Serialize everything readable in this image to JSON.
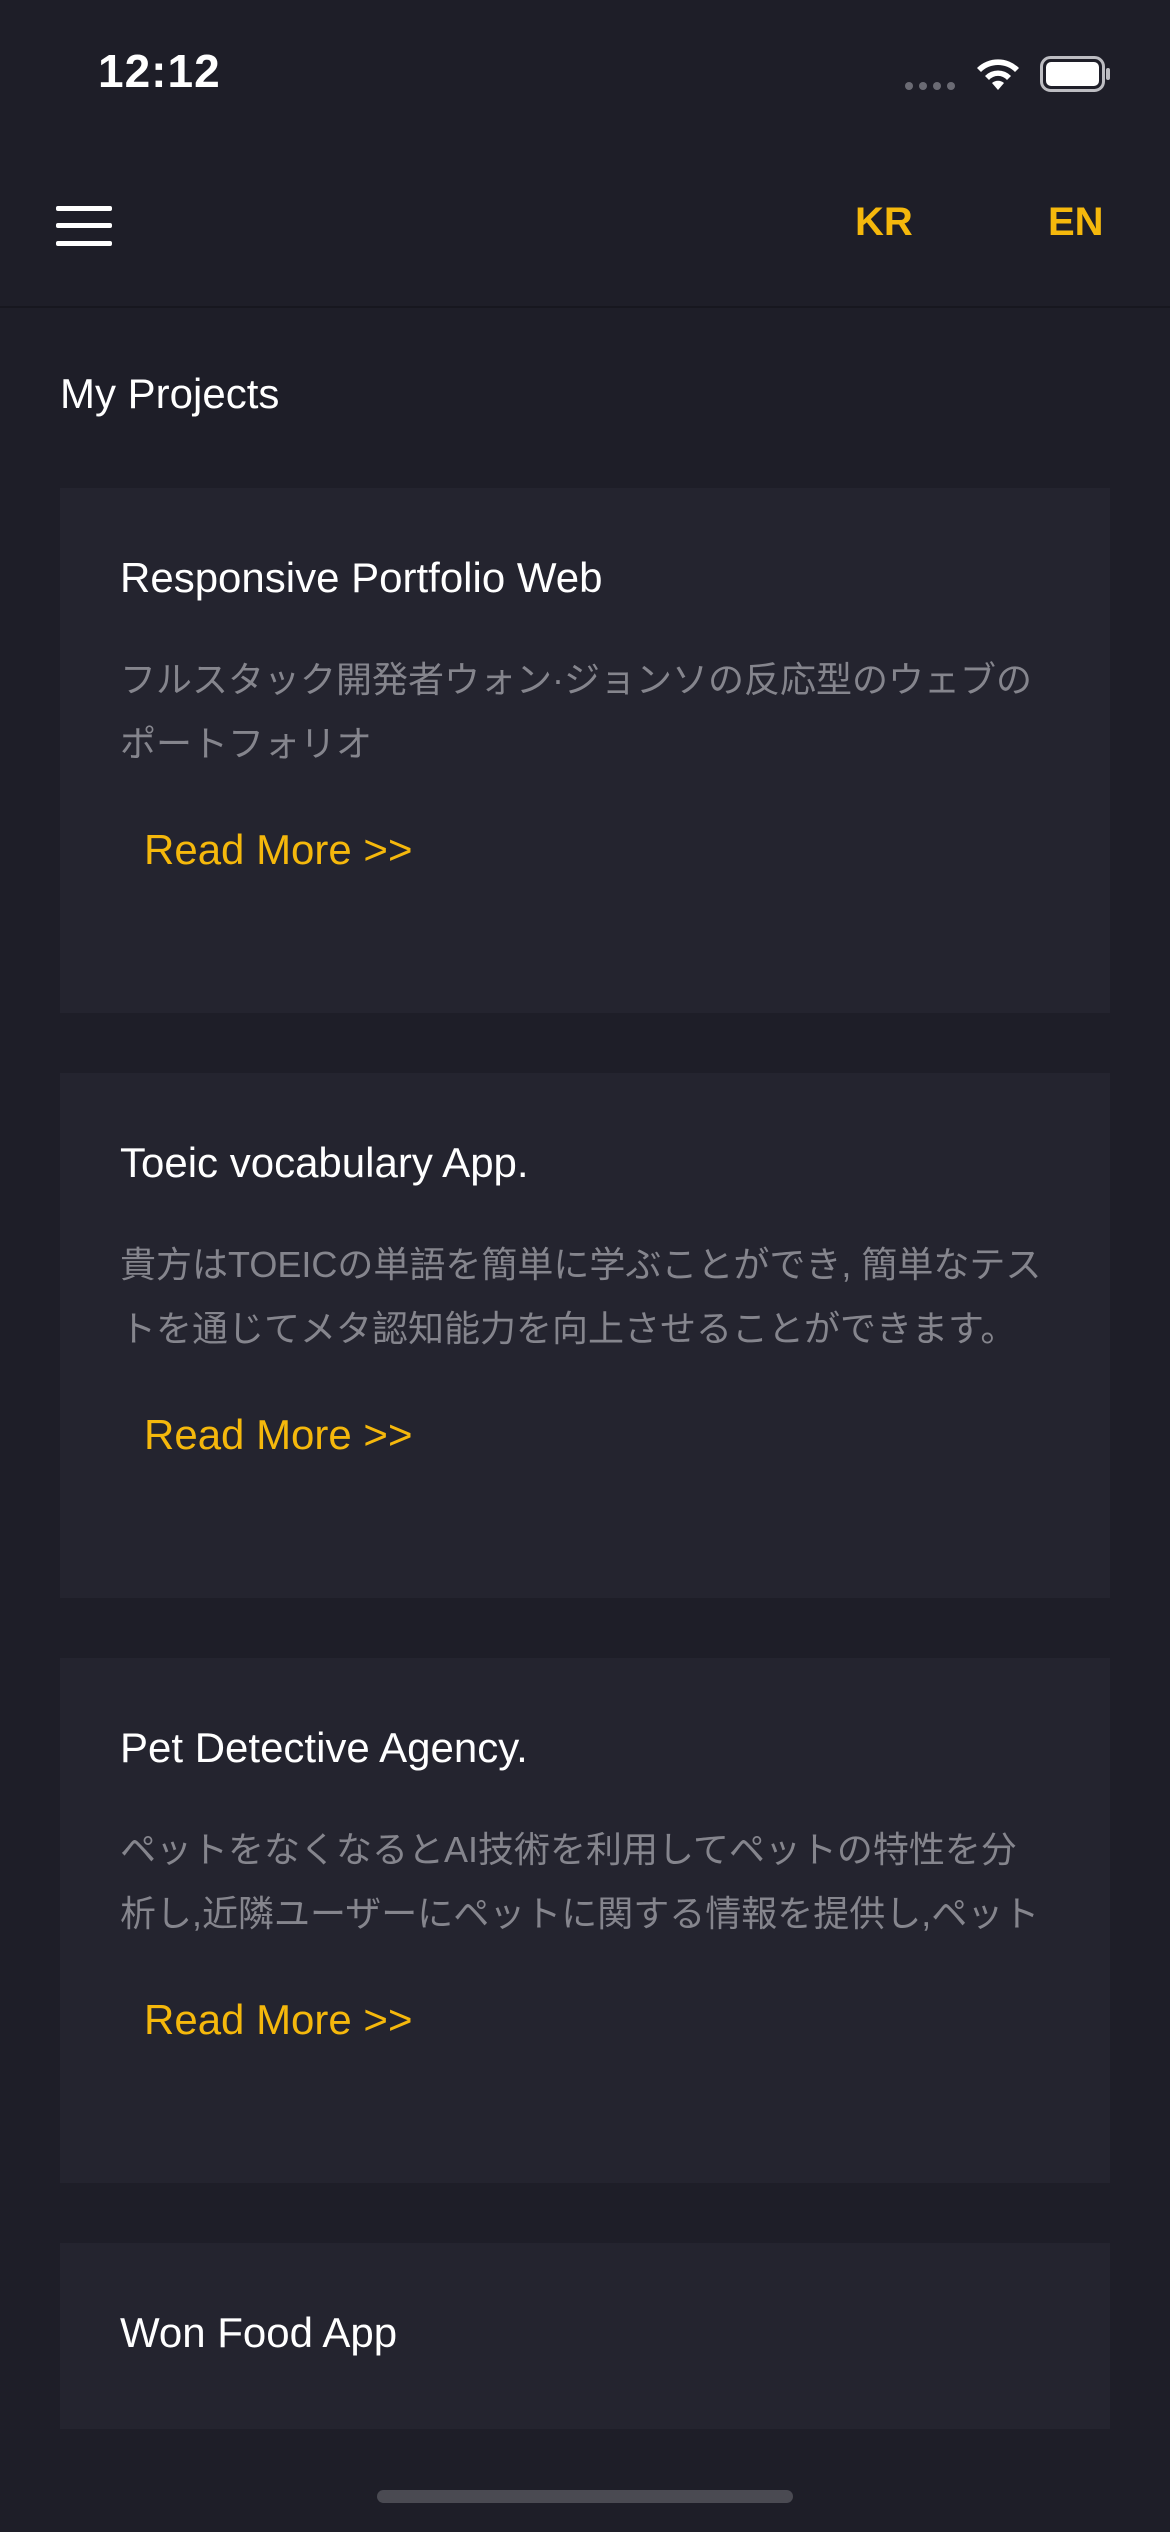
{
  "status_bar": {
    "time": "12:12"
  },
  "header": {
    "lang_kr": "KR",
    "lang_en": "EN"
  },
  "main": {
    "section_title": "My Projects",
    "projects": [
      {
        "title": "Responsive Portfolio Web",
        "description": "フルスタック開発者ウォン·ジョンソの反応型のウェブのポートフォリオ",
        "read_more": "Read More >>"
      },
      {
        "title": "Toeic vocabulary App.",
        "description": "貴方はTOEICの単語を簡単に学ぶことができ, 簡単なテストを通じてメタ認知能力を向上させることができます。内蔵された単語の他にも, 自分の単語を保存にて",
        "read_more": "Read More >>"
      },
      {
        "title": "Pet Detective Agency.",
        "description": "ペットをなくなるとAI技術を利用してペットの特性を分析し,近隣ユーザーにペットに関する情報を提供し,ペットを失うことを防ぐことができる",
        "read_more": "Read More >>"
      },
      {
        "title": "Won Food App"
      }
    ]
  },
  "colors": {
    "background": "#1e1e28",
    "card": "#24242f",
    "accent": "#f5b80c",
    "text_primary": "#ffffff",
    "text_secondary": "#85858d"
  },
  "icons": {
    "menu": "hamburger-menu-icon",
    "wifi": "wifi-icon",
    "battery": "battery-icon",
    "signal": "cellular-signal-icon"
  }
}
